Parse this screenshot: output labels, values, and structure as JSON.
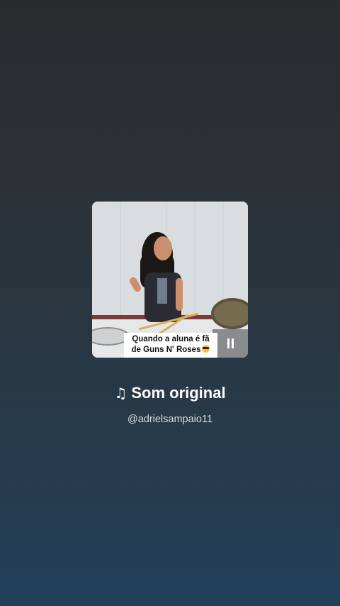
{
  "cover": {
    "caption_line1": "Quando a aluna é fã",
    "caption_line2": "de Guns N' Roses",
    "emoji": "sunglasses-emoji",
    "pause_icon": "pause-icon"
  },
  "audio": {
    "note_icon": "♫",
    "title": "Som original",
    "handle": "@adrielsampaio11"
  },
  "colors": {
    "background_top": "#2a2b2d",
    "background_bottom": "#23405a",
    "caption_bg": "#ffffff"
  }
}
